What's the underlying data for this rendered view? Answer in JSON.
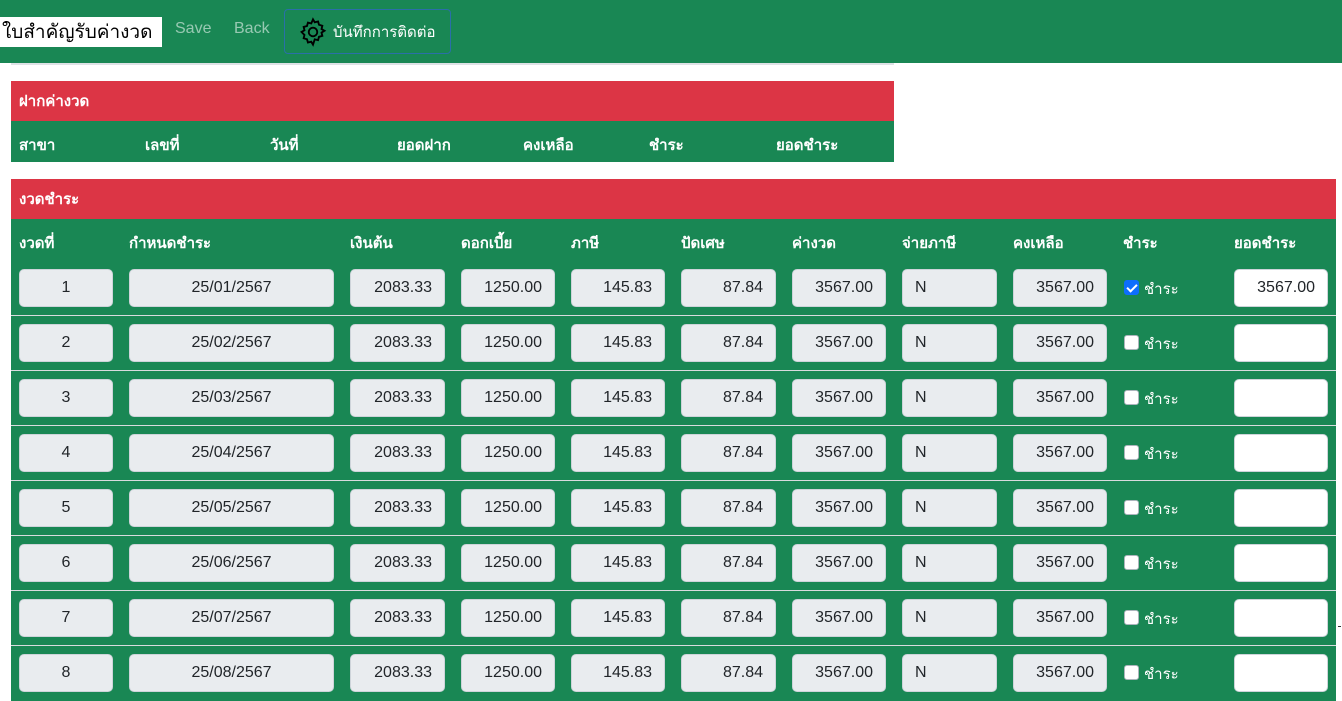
{
  "header": {
    "title": "ใบสำคัญรับค่างวด",
    "save_label": "Save",
    "back_label": "Back",
    "contact_label": "บันทึกการติดต่อ"
  },
  "deposit_section": {
    "title": "ฝากค่างวด",
    "columns": [
      "สาขา",
      "เลขที่",
      "วันที่",
      "ยอดฝาก",
      "คงเหลือ",
      "ชำระ",
      "ยอดชำระ"
    ]
  },
  "installment_section": {
    "title": "งวดชำระ",
    "columns": [
      "งวดที่",
      "กำหนดชำระ",
      "เงินต้น",
      "ดอกเบี้ย",
      "ภาษี",
      "ปัดเศษ",
      "ค่างวด",
      "จ่ายภาษี",
      "คงเหลือ",
      "ชำระ",
      "ยอดชำระ"
    ],
    "pay_checkbox_label": "ชำระ",
    "rows": [
      {
        "no": "1",
        "due": "25/01/2567",
        "principal": "2083.33",
        "interest": "1250.00",
        "tax": "145.83",
        "rounding": "87.84",
        "installment": "3567.00",
        "pay_tax": "N",
        "balance": "3567.00",
        "paid": true,
        "pay_amount": "3567.00"
      },
      {
        "no": "2",
        "due": "25/02/2567",
        "principal": "2083.33",
        "interest": "1250.00",
        "tax": "145.83",
        "rounding": "87.84",
        "installment": "3567.00",
        "pay_tax": "N",
        "balance": "3567.00",
        "paid": false,
        "pay_amount": ""
      },
      {
        "no": "3",
        "due": "25/03/2567",
        "principal": "2083.33",
        "interest": "1250.00",
        "tax": "145.83",
        "rounding": "87.84",
        "installment": "3567.00",
        "pay_tax": "N",
        "balance": "3567.00",
        "paid": false,
        "pay_amount": ""
      },
      {
        "no": "4",
        "due": "25/04/2567",
        "principal": "2083.33",
        "interest": "1250.00",
        "tax": "145.83",
        "rounding": "87.84",
        "installment": "3567.00",
        "pay_tax": "N",
        "balance": "3567.00",
        "paid": false,
        "pay_amount": ""
      },
      {
        "no": "5",
        "due": "25/05/2567",
        "principal": "2083.33",
        "interest": "1250.00",
        "tax": "145.83",
        "rounding": "87.84",
        "installment": "3567.00",
        "pay_tax": "N",
        "balance": "3567.00",
        "paid": false,
        "pay_amount": ""
      },
      {
        "no": "6",
        "due": "25/06/2567",
        "principal": "2083.33",
        "interest": "1250.00",
        "tax": "145.83",
        "rounding": "87.84",
        "installment": "3567.00",
        "pay_tax": "N",
        "balance": "3567.00",
        "paid": false,
        "pay_amount": ""
      },
      {
        "no": "7",
        "due": "25/07/2567",
        "principal": "2083.33",
        "interest": "1250.00",
        "tax": "145.83",
        "rounding": "87.84",
        "installment": "3567.00",
        "pay_tax": "N",
        "balance": "3567.00",
        "paid": false,
        "pay_amount": ""
      },
      {
        "no": "8",
        "due": "25/08/2567",
        "principal": "2083.33",
        "interest": "1250.00",
        "tax": "145.83",
        "rounding": "87.84",
        "installment": "3567.00",
        "pay_tax": "N",
        "balance": "3567.00",
        "paid": false,
        "pay_amount": ""
      }
    ]
  },
  "colors": {
    "green": "#198754",
    "red": "#dc3545",
    "checkbox": "#0d6efd"
  },
  "icons": {
    "contact": "gear-icon"
  }
}
